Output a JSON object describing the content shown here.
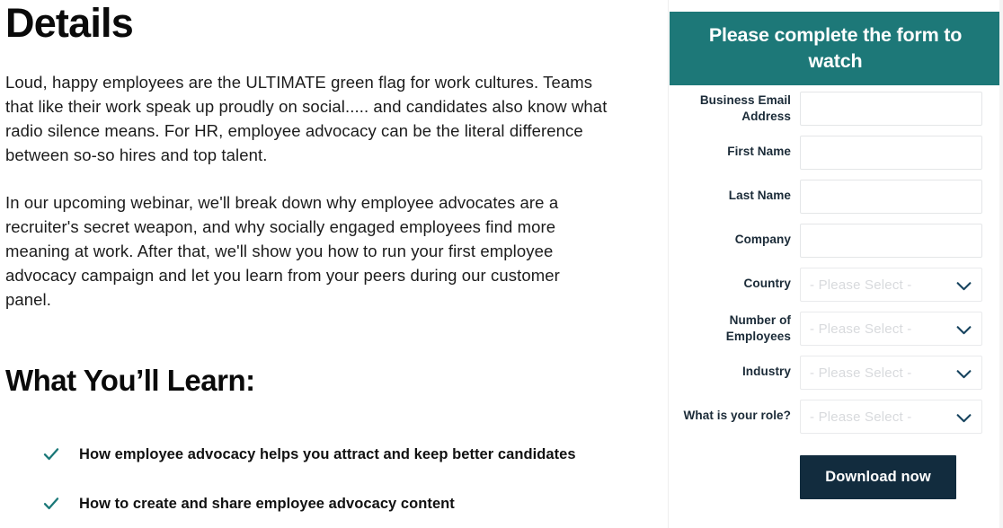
{
  "details": {
    "title": "Details",
    "paragraphs": [
      "Loud, happy employees are the ULTIMATE green flag for work cultures. Teams that like their work speak up proudly on social..... and candidates also know what radio silence means. For HR, employee advocacy can be the literal difference between so-so hires and top talent.",
      "In our upcoming webinar, we'll break down why employee advocates are a recruiter's secret weapon, and why socially engaged employees find more meaning at work. After that, we'll show you how to run your first employee advocacy campaign and let you learn from your peers during our customer panel."
    ],
    "learn_heading": "What You’ll Learn:",
    "bullets": [
      {
        "icon": "check-icon",
        "text": "How employee advocacy helps you attract and keep better candidates"
      },
      {
        "icon": "check-icon",
        "text": "How to create and share employee advocacy content"
      }
    ]
  },
  "form": {
    "header": "Please complete the form to watch",
    "select_placeholder": "- Please Select -",
    "fields": [
      {
        "label": "Business Email Address",
        "type": "text",
        "value": "",
        "placeholder": "",
        "two_line": true
      },
      {
        "label": "First Name",
        "type": "text",
        "value": "",
        "placeholder": "",
        "two_line": false
      },
      {
        "label": "Last Name",
        "type": "text",
        "value": "",
        "placeholder": "",
        "two_line": false
      },
      {
        "label": "Company",
        "type": "text",
        "value": "",
        "placeholder": "",
        "two_line": false
      },
      {
        "label": "Country",
        "type": "select",
        "value": "- Please Select -",
        "two_line": false
      },
      {
        "label": "Number of Employees",
        "type": "select",
        "value": "- Please Select -",
        "two_line": true
      },
      {
        "label": "Industry",
        "type": "select",
        "value": "- Please Select -",
        "two_line": false
      },
      {
        "label": "What is your role?",
        "type": "select",
        "value": "- Please Select -",
        "two_line": false
      }
    ],
    "submit_label": "Download now"
  },
  "colors": {
    "header_teal": "#1d7878",
    "check_teal": "#1a7878",
    "button_navy": "#122c3e",
    "chevron_navy": "#16435e",
    "text_dark": "#1c1c1c",
    "placeholder_gray": "#d8dadd"
  }
}
